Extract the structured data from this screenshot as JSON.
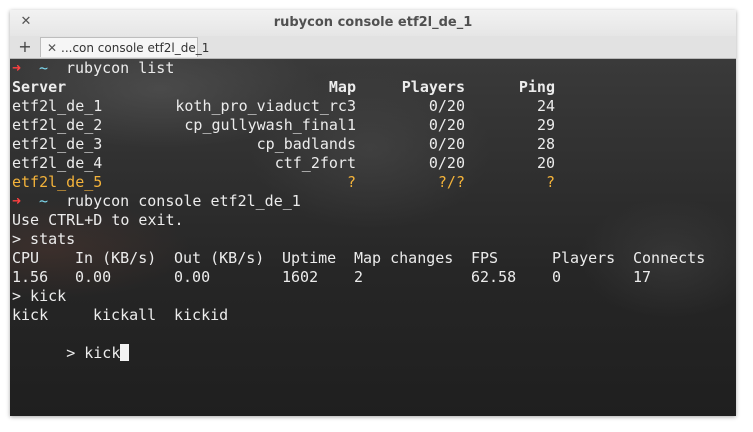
{
  "window": {
    "title": "rubycon console etf2l_de_1"
  },
  "titlebar": {
    "close_glyph": "✕"
  },
  "tabs": {
    "new_tab_glyph": "+",
    "active": {
      "close_glyph": "✕",
      "label": "...con console etf2l_de_1"
    }
  },
  "prompt": {
    "arrow": "➜",
    "tilde": "~"
  },
  "terminal": {
    "cmd1": "rubycon list",
    "table": {
      "headers": [
        "Server",
        "Map",
        "Players",
        "Ping"
      ],
      "rows": [
        [
          "etf2l_de_1",
          "koth_pro_viaduct_rc3",
          "0/20",
          "24"
        ],
        [
          "etf2l_de_2",
          "cp_gullywash_final1",
          "0/20",
          "29"
        ],
        [
          "etf2l_de_3",
          "cp_badlands",
          "0/20",
          "28"
        ],
        [
          "etf2l_de_4",
          "ctf_2fort",
          "0/20",
          "20"
        ],
        [
          "etf2l_de_5",
          "?",
          "?/?",
          "?"
        ]
      ]
    },
    "cmd2": "rubycon console etf2l_de_1",
    "exit_hint": "Use CTRL+D to exit.",
    "stats_cmd": "> stats",
    "stats": {
      "headers": [
        "CPU",
        "In (KB/s)",
        "Out (KB/s)",
        "Uptime",
        "Map changes",
        "FPS",
        "Players",
        "Connects"
      ],
      "values": [
        "1.56",
        "0.00",
        "0.00",
        "1602",
        "2",
        "62.58",
        "0",
        "17"
      ]
    },
    "kick_cmd": "> kick",
    "completions": [
      "kick",
      "kickall",
      "kickid"
    ],
    "current_input": "> kick"
  },
  "colors": {
    "prompt_arrow": "#ff4040",
    "prompt_tilde": "#7ed8ee",
    "offline_row": "#f4b33a",
    "text": "#ececec"
  }
}
